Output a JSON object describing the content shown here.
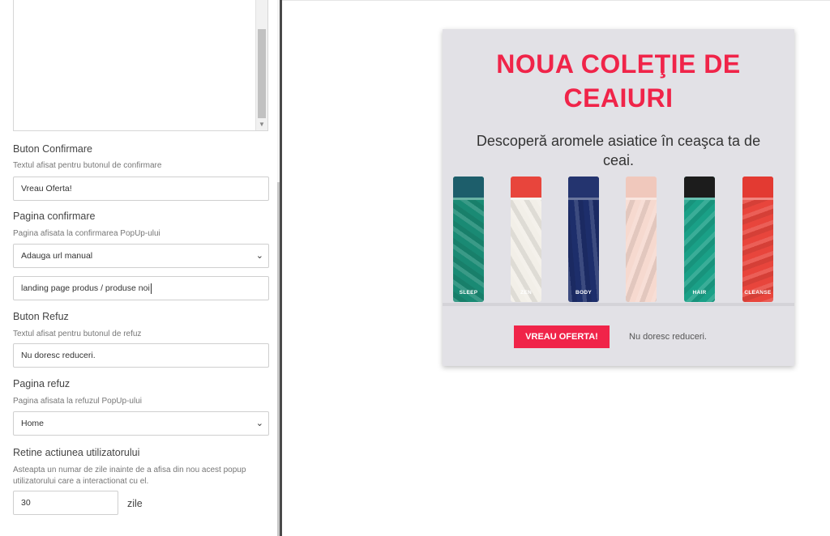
{
  "form": {
    "confirm_button": {
      "label": "Buton Confirmare",
      "hint": "Textul afisat pentru butonul de confirmare",
      "value": "Vreau  Oferta!"
    },
    "confirm_page": {
      "label": "Pagina confirmare",
      "hint": "Pagina afisata la confirmarea PopUp-ului",
      "select_value": "Adauga url manual",
      "url_value": "landing page produs / produse noi"
    },
    "refuse_button": {
      "label": "Buton Refuz",
      "hint": "Textul afisat pentru butonul de refuz",
      "value": "Nu doresc reduceri."
    },
    "refuse_page": {
      "label": "Pagina refuz",
      "hint": "Pagina afisata la refuzul PopUp-ului",
      "select_value": "Home"
    },
    "retain": {
      "label": "Retine actiunea utilizatorului",
      "hint": "Asteapta un numar de zile inainte de a afisa din nou acest popup utilizatorului care a interactionat cu el.",
      "days_value": "30",
      "unit": "zile"
    }
  },
  "popup": {
    "title_line1": "NOUA COLEŢIE DE",
    "title_line2": "CEAIURI",
    "subtitle": "Descoperă aromele asiatice în ceaşca ta de ceai.",
    "confirm_label": "VREAU OFERTA!",
    "refuse_label": "Nu doresc reduceri.",
    "accent_color": "#f02449",
    "products": [
      {
        "name": "SLEEP",
        "color": "#1a8a74",
        "lid": "#1d5e6b"
      },
      {
        "name": "ZEN",
        "color": "#f2efe8",
        "lid": "#e8453c"
      },
      {
        "name": "BODY",
        "color": "#1d2e6b",
        "lid": "#24346f"
      },
      {
        "name": "",
        "color": "#f6d9cf",
        "lid": "#f0c8bc"
      },
      {
        "name": "HAIR",
        "color": "#1aa087",
        "lid": "#1c1c1c"
      },
      {
        "name": "CLEANSE",
        "color": "#e8453c",
        "lid": "#e33a32"
      }
    ]
  }
}
